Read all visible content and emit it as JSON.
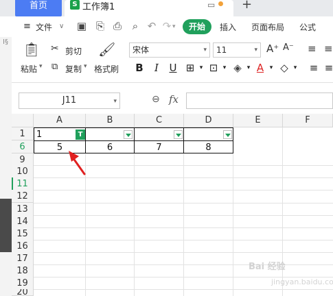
{
  "tabs": {
    "home_label": "首页",
    "doc_title": "工作簿1",
    "doc_icon_letter": "S"
  },
  "menu": {
    "file_label": "文件",
    "start_label": "开始",
    "insert_label": "插入",
    "page_layout_label": "页面布局",
    "formula_label": "公式"
  },
  "ribbon": {
    "paste_label": "粘贴",
    "cut_label": "剪切",
    "copy_label": "复制",
    "format_painter_label": "格式刷",
    "font_name": "宋体",
    "font_size": "11",
    "bold": "B",
    "italic": "I",
    "underline": "U"
  },
  "formula_bar": {
    "cell_ref": "J11",
    "fx_label": "fx"
  },
  "grid": {
    "columns": [
      "A",
      "B",
      "C",
      "D",
      "E",
      "F"
    ],
    "rows": [
      "1",
      "6",
      "9",
      "10",
      "11",
      "12",
      "13",
      "14",
      "15",
      "16",
      "17",
      "18",
      "19",
      "20"
    ],
    "active_row": "11",
    "header_row": {
      "A": "1"
    },
    "data_row": {
      "A": "5",
      "B": "6",
      "C": "7",
      "D": "8"
    }
  },
  "watermark": "Bai 经验",
  "watermark_sub": "jingyan.baidu.com",
  "colors": {
    "accent": "#20a05c",
    "tab_blue": "#4c7cf3",
    "arrow_red": "#e02020"
  }
}
